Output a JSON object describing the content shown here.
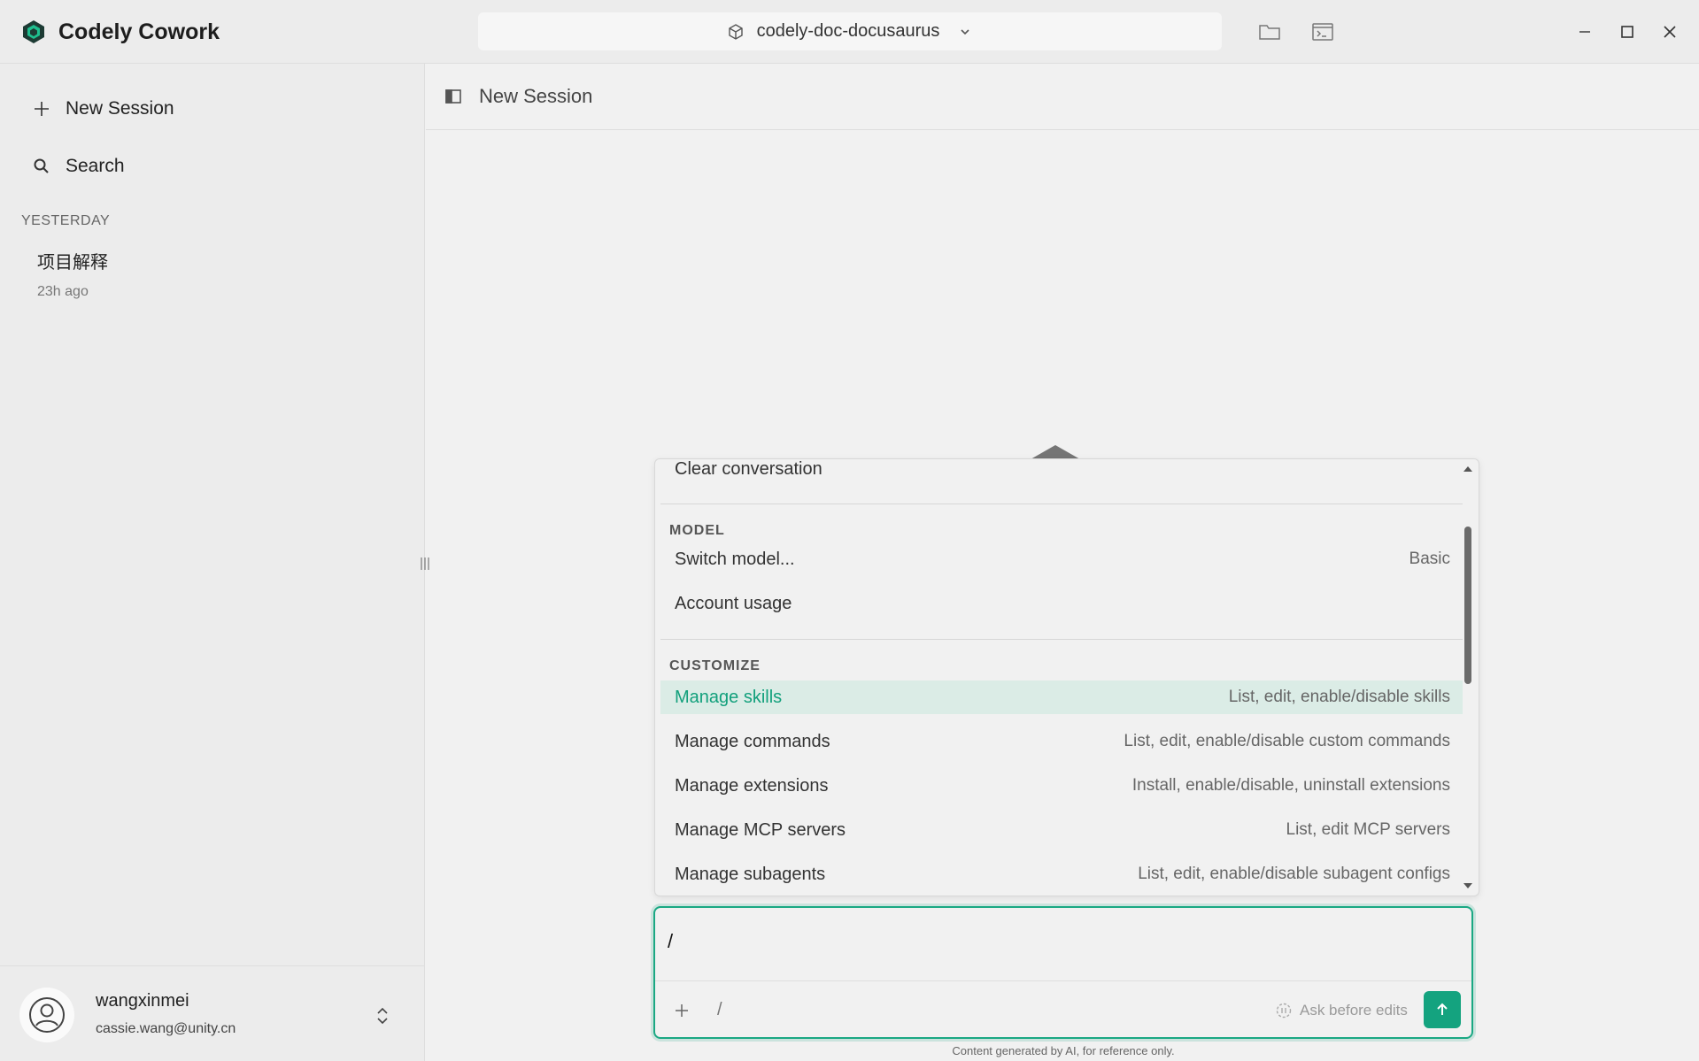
{
  "app": {
    "name": "Codely Cowork",
    "accent_color": "#14a37f"
  },
  "titlebar": {
    "project_name": "codely-doc-docusaurus",
    "icons": [
      "cube-icon",
      "chevron-down-icon",
      "folder-icon",
      "terminal-icon",
      "minimize-icon",
      "maximize-icon",
      "close-icon"
    ]
  },
  "sidebar": {
    "new_session_label": "New Session",
    "search_label": "Search",
    "group_label": "YESTERDAY",
    "sessions": [
      {
        "title": "项目解释",
        "time": "23h ago"
      }
    ],
    "user": {
      "name": "wangxinmei",
      "email": "cassie.wang@unity.cn"
    }
  },
  "main": {
    "session_title": "New Session"
  },
  "palette": {
    "top_item": {
      "label": "Clear conversation"
    },
    "sections": [
      {
        "title": "MODEL",
        "items": [
          {
            "label": "Switch model...",
            "desc": "Basic"
          },
          {
            "label": "Account usage",
            "desc": ""
          }
        ]
      },
      {
        "title": "CUSTOMIZE",
        "items": [
          {
            "label": "Manage skills",
            "desc": "List, edit, enable/disable skills",
            "active": true
          },
          {
            "label": "Manage commands",
            "desc": "List, edit, enable/disable custom commands"
          },
          {
            "label": "Manage extensions",
            "desc": "Install, enable/disable, uninstall extensions"
          },
          {
            "label": "Manage MCP servers",
            "desc": "List, edit MCP servers"
          },
          {
            "label": "Manage subagents",
            "desc": "List, edit, enable/disable subagent configs"
          }
        ]
      }
    ]
  },
  "composer": {
    "value": "/",
    "slash_hint": "/",
    "mode_label": "Ask before edits"
  },
  "footer": {
    "note": "Content generated by AI, for reference only."
  }
}
